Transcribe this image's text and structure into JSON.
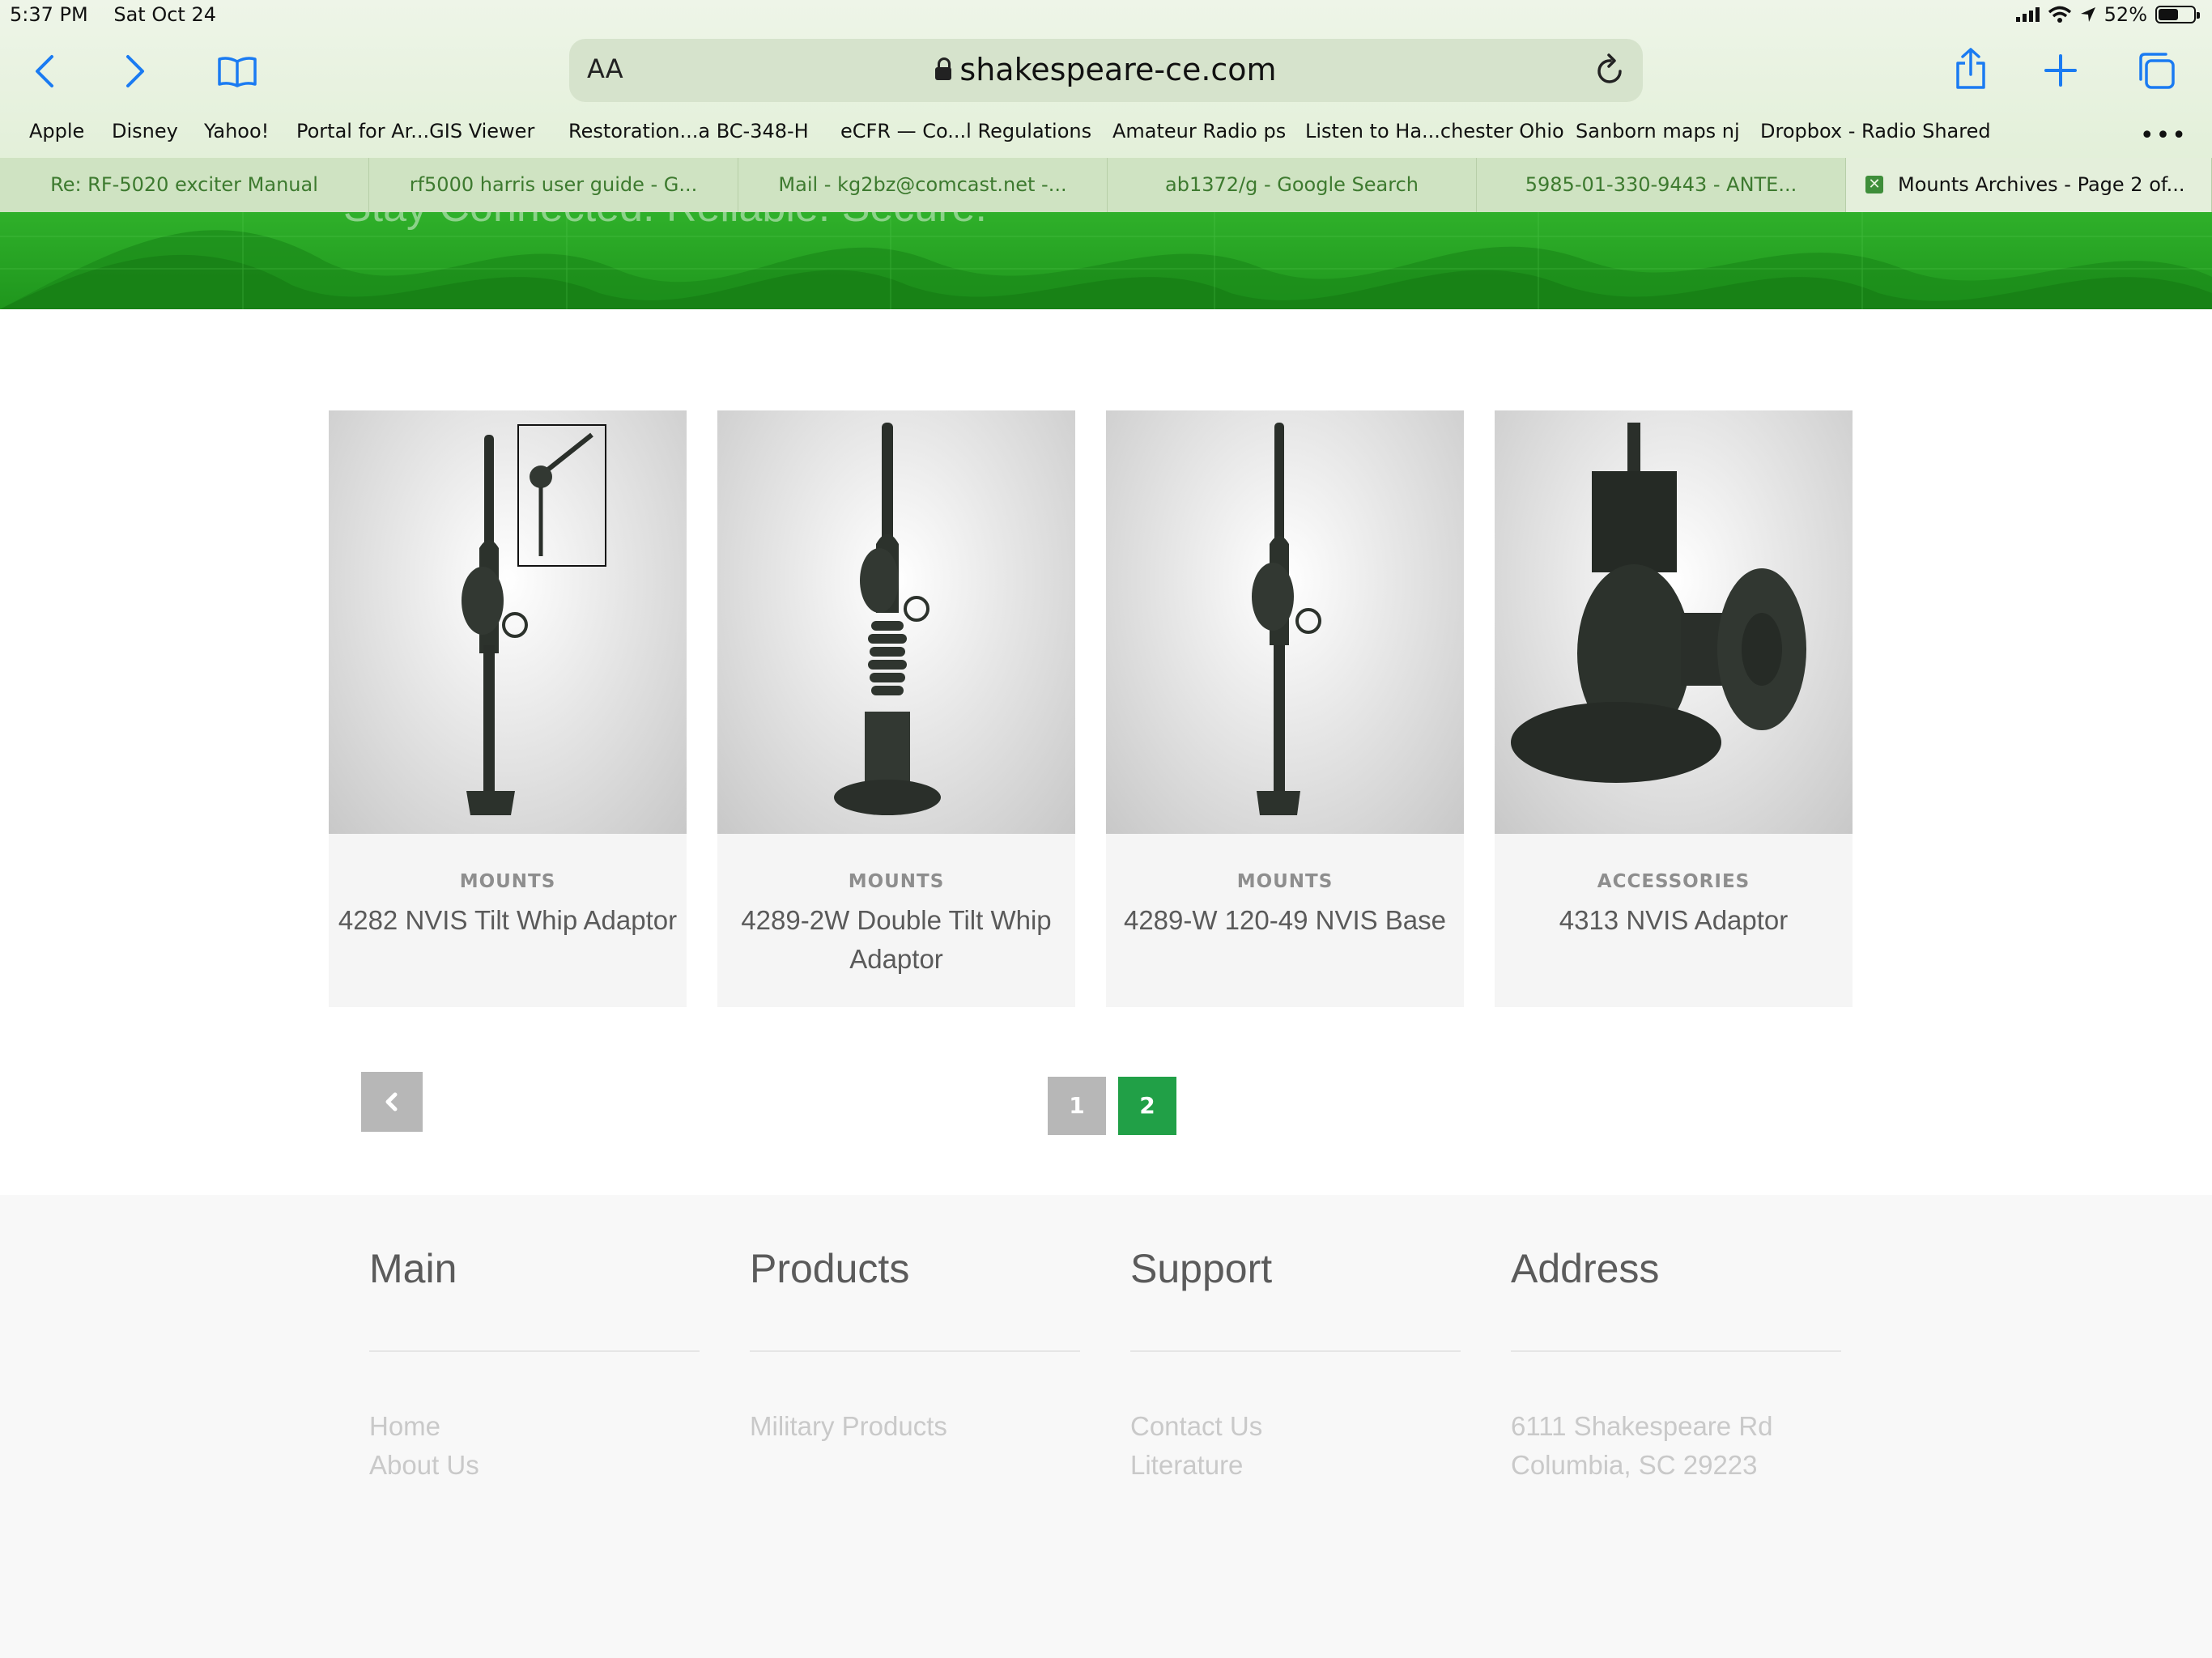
{
  "status_bar": {
    "time": "5:37 PM",
    "date": "Sat Oct 24",
    "battery": "52%"
  },
  "browser": {
    "text_size_label": "AA",
    "url": "shakespeare-ce.com",
    "bookmarks": [
      "Apple",
      "Disney",
      "Yahoo!",
      "Portal for Ar...GIS Viewer",
      "Restoration...a BC-348-H",
      "eCFR — Co...l Regulations",
      "Amateur Radio ps",
      "Listen to Ha...chester Ohio",
      "Sanborn maps nj",
      "Dropbox - Radio Shared"
    ],
    "more": "•••",
    "tabs": [
      "Re: RF-5020 exciter Manual",
      "rf5000 harris user guide - G...",
      "Mail - kg2bz@comcast.net -...",
      "ab1372/g - Google Search",
      "5985-01-330-9443 - ANTE...",
      "Mounts Archives - Page 2 of..."
    ],
    "active_tab_close": "✕"
  },
  "hero": {
    "tagline": "Stay Connected. Reliable. Secure."
  },
  "products": [
    {
      "category": "MOUNTS",
      "title": "4282 NVIS Tilt Whip Adaptor"
    },
    {
      "category": "MOUNTS",
      "title": "4289-2W Double Tilt Whip Adaptor"
    },
    {
      "category": "MOUNTS",
      "title": "4289-W 120-49 NVIS Base"
    },
    {
      "category": "ACCESSORIES",
      "title": "4313 NVIS Adaptor"
    }
  ],
  "pagination": {
    "pages": [
      "1",
      "2"
    ],
    "current": "2"
  },
  "footer": {
    "main": {
      "heading": "Main",
      "links": [
        "Home",
        "About Us"
      ]
    },
    "products": {
      "heading": "Products",
      "links": [
        "Military Products"
      ]
    },
    "support": {
      "heading": "Support",
      "links": [
        "Contact Us",
        "Literature"
      ]
    },
    "address": {
      "heading": "Address",
      "lines": [
        "6111 Shakespeare Rd",
        "Columbia, SC 29223"
      ]
    }
  },
  "colors": {
    "brand_green": "#21a047",
    "hero_green": "#27a324",
    "link_blue": "#1a7bf2",
    "pagination_inactive": "#b7b7b7"
  },
  "icons": [
    "back-icon",
    "forward-icon",
    "bookmarks-icon",
    "lock-icon",
    "reload-icon",
    "share-icon",
    "new-tab-icon",
    "tabs-icon",
    "chevron-left-icon"
  ]
}
